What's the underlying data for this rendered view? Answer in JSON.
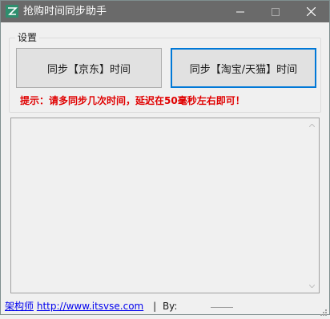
{
  "window": {
    "title": "抢购时间同步助手",
    "min_glyph": "—",
    "max_glyph": "☐",
    "close_glyph": "✕"
  },
  "settings": {
    "group_label": "设置",
    "sync_jd_button": "同步【京东】时间",
    "sync_taobao_button": "同步【淘宝/天猫】时间",
    "hint": "提示：请多同步几次时间，延迟在50毫秒左右即可！"
  },
  "log": {
    "content": ""
  },
  "footer": {
    "author": "架构师",
    "url": "http://www.itsvse.com",
    "separator": "|",
    "by_label": "By:"
  },
  "colors": {
    "titlebar": "#6a6a6a",
    "hint": "#e00000",
    "focus_border": "#0078d7",
    "link": "#0000ee"
  },
  "icons": {
    "app": "app-logo-icon",
    "minimize": "minimize-icon",
    "maximize": "maximize-icon",
    "close": "close-icon",
    "scroll_up": "scroll-up-arrow-icon",
    "scroll_down": "scroll-down-arrow-icon",
    "resize": "resize-grip-icon"
  }
}
